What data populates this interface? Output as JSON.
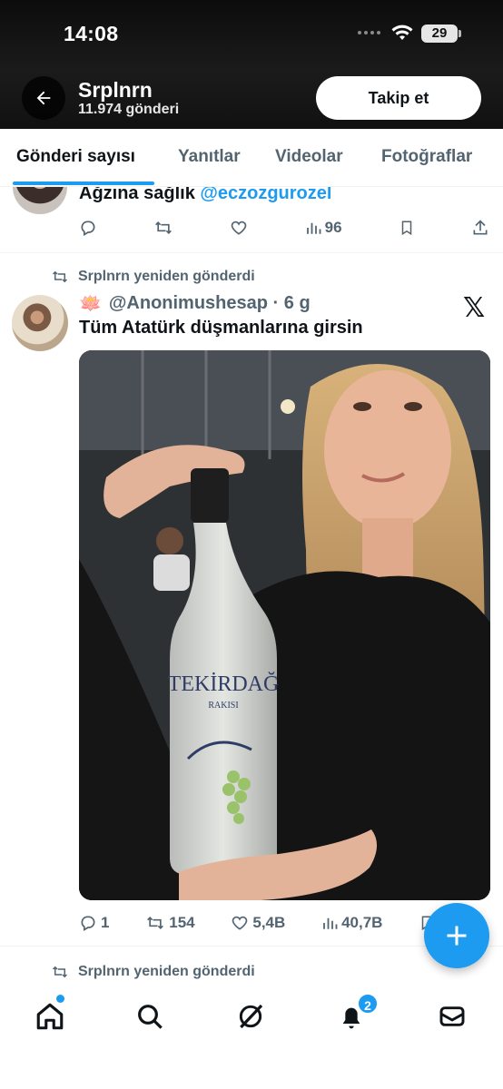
{
  "status_bar": {
    "time": "14:08",
    "battery": "29"
  },
  "header": {
    "name": "Srplnrn",
    "post_count": "11.974 gönderi",
    "follow_label": "Takip et"
  },
  "tabs": [
    {
      "label": "Gönderi sayısı",
      "active": true
    },
    {
      "label": "Yanıtlar",
      "active": false
    },
    {
      "label": "Videolar",
      "active": false
    },
    {
      "label": "Fotoğraflar",
      "active": false
    }
  ],
  "reply_post": {
    "text_prefix": "Ağzına sağlık ",
    "mention": "@eczozgurozel",
    "views": "96"
  },
  "repost": {
    "reposted_by": "Srplnrn yeniden gönderdi",
    "emoji": "🪷",
    "author": "@Anonimushesap · 6 g",
    "text": "Tüm Atatürk düşmanlarına girsin",
    "bottle_brand": "TEKİRDAĞ",
    "bottle_sub": "RAKISI",
    "replies": "1",
    "reposts": "154",
    "likes": "5,4B",
    "views": "40,7B"
  },
  "next_repost": {
    "reposted_by": "Srplnrn yeniden gönderdi"
  },
  "nav": {
    "notification_badge": "2"
  },
  "colors": {
    "accent": "#1d9bf0",
    "text": "#0f1419",
    "secondary": "#536471"
  }
}
